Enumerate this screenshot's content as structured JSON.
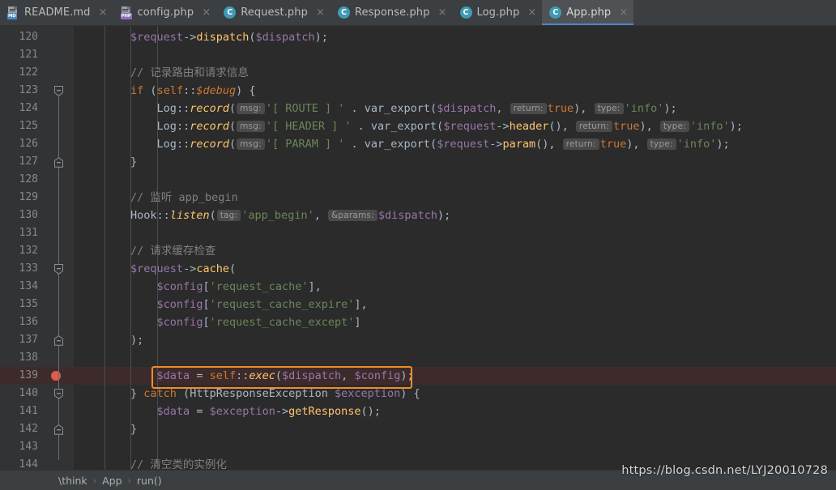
{
  "window": {
    "app": "PhpStorm",
    "theme_bg": "#2b2b2b",
    "accent": "#4a88c7",
    "annotation_color": "#f08b2b",
    "breakpoint_color": "#e05a52"
  },
  "tabs": [
    {
      "label": "README.md",
      "icon": "markdown-file-icon",
      "badge": "MD",
      "active": false,
      "close": "×"
    },
    {
      "label": "config.php",
      "icon": "php-file-icon",
      "badge": "PHP",
      "active": false,
      "close": "×"
    },
    {
      "label": "Request.php",
      "icon": "php-class-icon",
      "badge": "C",
      "active": false,
      "close": "×"
    },
    {
      "label": "Response.php",
      "icon": "php-class-icon",
      "badge": "C",
      "active": false,
      "close": "×"
    },
    {
      "label": "Log.php",
      "icon": "php-class-icon",
      "badge": "C",
      "active": false,
      "close": "×"
    },
    {
      "label": "App.php",
      "icon": "php-class-icon",
      "badge": "C",
      "active": true,
      "close": "×"
    }
  ],
  "editor": {
    "first_line": 120,
    "last_line": 144,
    "line_height": 22,
    "highlighted_line": 139,
    "breakpoint_line": 139,
    "fold_lines": [
      123,
      127,
      133,
      137,
      140,
      142
    ],
    "annotated_line": 139,
    "lines": [
      {
        "n": 120,
        "tokens": [
          {
            "t": "        ",
            "c": "plain"
          },
          {
            "t": "$request",
            "c": "var"
          },
          {
            "t": "->",
            "c": "def"
          },
          {
            "t": "dispatch",
            "c": "fn"
          },
          {
            "t": "(",
            "c": "def"
          },
          {
            "t": "$dispatch",
            "c": "var"
          },
          {
            "t": ");",
            "c": "def"
          }
        ]
      },
      {
        "n": 121,
        "tokens": []
      },
      {
        "n": 122,
        "tokens": [
          {
            "t": "        ",
            "c": "plain"
          },
          {
            "t": "// 记录路由和请求信息",
            "c": "cmt"
          }
        ]
      },
      {
        "n": 123,
        "tokens": [
          {
            "t": "        ",
            "c": "plain"
          },
          {
            "t": "if",
            "c": "kw"
          },
          {
            "t": " (",
            "c": "def"
          },
          {
            "t": "self",
            "c": "kw"
          },
          {
            "t": "::",
            "c": "def"
          },
          {
            "t": "$debug",
            "c": "kwi"
          },
          {
            "t": ") {",
            "c": "def"
          }
        ]
      },
      {
        "n": 124,
        "tokens": [
          {
            "t": "            ",
            "c": "plain"
          },
          {
            "t": "Log",
            "c": "def"
          },
          {
            "t": "::",
            "c": "def"
          },
          {
            "t": "record",
            "c": "itl"
          },
          {
            "t": "(",
            "c": "def"
          },
          {
            "t": "msg:",
            "c": "hint"
          },
          {
            "t": "'[ ROUTE ] '",
            "c": "str"
          },
          {
            "t": " . ",
            "c": "def"
          },
          {
            "t": "var_export",
            "c": "def"
          },
          {
            "t": "(",
            "c": "def"
          },
          {
            "t": "$dispatch",
            "c": "var"
          },
          {
            "t": ", ",
            "c": "def"
          },
          {
            "t": "return:",
            "c": "hint"
          },
          {
            "t": "true",
            "c": "kw"
          },
          {
            "t": "), ",
            "c": "def"
          },
          {
            "t": "type:",
            "c": "hint"
          },
          {
            "t": "'info'",
            "c": "str"
          },
          {
            "t": ");",
            "c": "def"
          }
        ]
      },
      {
        "n": 125,
        "tokens": [
          {
            "t": "            ",
            "c": "plain"
          },
          {
            "t": "Log",
            "c": "def"
          },
          {
            "t": "::",
            "c": "def"
          },
          {
            "t": "record",
            "c": "itl"
          },
          {
            "t": "(",
            "c": "def"
          },
          {
            "t": "msg:",
            "c": "hint"
          },
          {
            "t": "'[ HEADER ] '",
            "c": "str"
          },
          {
            "t": " . ",
            "c": "def"
          },
          {
            "t": "var_export",
            "c": "def"
          },
          {
            "t": "(",
            "c": "def"
          },
          {
            "t": "$request",
            "c": "var"
          },
          {
            "t": "->",
            "c": "def"
          },
          {
            "t": "header",
            "c": "fn"
          },
          {
            "t": "(), ",
            "c": "def"
          },
          {
            "t": "return:",
            "c": "hint"
          },
          {
            "t": "true",
            "c": "kw"
          },
          {
            "t": "), ",
            "c": "def"
          },
          {
            "t": "type:",
            "c": "hint"
          },
          {
            "t": "'info'",
            "c": "str"
          },
          {
            "t": ");",
            "c": "def"
          }
        ]
      },
      {
        "n": 126,
        "tokens": [
          {
            "t": "            ",
            "c": "plain"
          },
          {
            "t": "Log",
            "c": "def"
          },
          {
            "t": "::",
            "c": "def"
          },
          {
            "t": "record",
            "c": "itl"
          },
          {
            "t": "(",
            "c": "def"
          },
          {
            "t": "msg:",
            "c": "hint"
          },
          {
            "t": "'[ PARAM ] '",
            "c": "str"
          },
          {
            "t": " . ",
            "c": "def"
          },
          {
            "t": "var_export",
            "c": "def"
          },
          {
            "t": "(",
            "c": "def"
          },
          {
            "t": "$request",
            "c": "var"
          },
          {
            "t": "->",
            "c": "def"
          },
          {
            "t": "param",
            "c": "fn"
          },
          {
            "t": "(), ",
            "c": "def"
          },
          {
            "t": "return:",
            "c": "hint"
          },
          {
            "t": "true",
            "c": "kw"
          },
          {
            "t": "), ",
            "c": "def"
          },
          {
            "t": "type:",
            "c": "hint"
          },
          {
            "t": "'info'",
            "c": "str"
          },
          {
            "t": ");",
            "c": "def"
          }
        ]
      },
      {
        "n": 127,
        "tokens": [
          {
            "t": "        }",
            "c": "def"
          }
        ]
      },
      {
        "n": 128,
        "tokens": []
      },
      {
        "n": 129,
        "tokens": [
          {
            "t": "        ",
            "c": "plain"
          },
          {
            "t": "// 监听 app_begin",
            "c": "cmt"
          }
        ]
      },
      {
        "n": 130,
        "tokens": [
          {
            "t": "        ",
            "c": "plain"
          },
          {
            "t": "Hook",
            "c": "def"
          },
          {
            "t": "::",
            "c": "def"
          },
          {
            "t": "listen",
            "c": "itl"
          },
          {
            "t": "(",
            "c": "def"
          },
          {
            "t": "tag:",
            "c": "hint"
          },
          {
            "t": "'app_begin'",
            "c": "str"
          },
          {
            "t": ", ",
            "c": "def"
          },
          {
            "t": "&params:",
            "c": "hint"
          },
          {
            "t": "$dispatch",
            "c": "var"
          },
          {
            "t": ");",
            "c": "def"
          }
        ]
      },
      {
        "n": 131,
        "tokens": []
      },
      {
        "n": 132,
        "tokens": [
          {
            "t": "        ",
            "c": "plain"
          },
          {
            "t": "// 请求缓存检查",
            "c": "cmt"
          }
        ]
      },
      {
        "n": 133,
        "tokens": [
          {
            "t": "        ",
            "c": "plain"
          },
          {
            "t": "$request",
            "c": "var"
          },
          {
            "t": "->",
            "c": "def"
          },
          {
            "t": "cache",
            "c": "fn"
          },
          {
            "t": "(",
            "c": "def"
          }
        ]
      },
      {
        "n": 134,
        "tokens": [
          {
            "t": "            ",
            "c": "plain"
          },
          {
            "t": "$config",
            "c": "var"
          },
          {
            "t": "[",
            "c": "def"
          },
          {
            "t": "'request_cache'",
            "c": "str"
          },
          {
            "t": "],",
            "c": "def"
          }
        ]
      },
      {
        "n": 135,
        "tokens": [
          {
            "t": "            ",
            "c": "plain"
          },
          {
            "t": "$config",
            "c": "var"
          },
          {
            "t": "[",
            "c": "def"
          },
          {
            "t": "'request_cache_expire'",
            "c": "str"
          },
          {
            "t": "],",
            "c": "def"
          }
        ]
      },
      {
        "n": 136,
        "tokens": [
          {
            "t": "            ",
            "c": "plain"
          },
          {
            "t": "$config",
            "c": "var"
          },
          {
            "t": "[",
            "c": "def"
          },
          {
            "t": "'request_cache_except'",
            "c": "str"
          },
          {
            "t": "]",
            "c": "def"
          }
        ]
      },
      {
        "n": 137,
        "tokens": [
          {
            "t": "        );",
            "c": "def"
          }
        ]
      },
      {
        "n": 138,
        "tokens": []
      },
      {
        "n": 139,
        "tokens": [
          {
            "t": "            ",
            "c": "plain"
          },
          {
            "t": "$data",
            "c": "var"
          },
          {
            "t": " = ",
            "c": "def"
          },
          {
            "t": "self",
            "c": "kw"
          },
          {
            "t": "::",
            "c": "def"
          },
          {
            "t": "exec",
            "c": "itl"
          },
          {
            "t": "(",
            "c": "def"
          },
          {
            "t": "$dispatch",
            "c": "var"
          },
          {
            "t": ", ",
            "c": "def"
          },
          {
            "t": "$config",
            "c": "var"
          },
          {
            "t": ");",
            "c": "def"
          }
        ]
      },
      {
        "n": 140,
        "tokens": [
          {
            "t": "        } ",
            "c": "def"
          },
          {
            "t": "catch",
            "c": "kw"
          },
          {
            "t": " (",
            "c": "def"
          },
          {
            "t": "HttpResponseException",
            "c": "def"
          },
          {
            "t": " ",
            "c": "plain"
          },
          {
            "t": "$exception",
            "c": "var"
          },
          {
            "t": ") {",
            "c": "def"
          }
        ]
      },
      {
        "n": 141,
        "tokens": [
          {
            "t": "            ",
            "c": "plain"
          },
          {
            "t": "$data",
            "c": "var"
          },
          {
            "t": " = ",
            "c": "def"
          },
          {
            "t": "$exception",
            "c": "var"
          },
          {
            "t": "->",
            "c": "def"
          },
          {
            "t": "getResponse",
            "c": "fn"
          },
          {
            "t": "();",
            "c": "def"
          }
        ]
      },
      {
        "n": 142,
        "tokens": [
          {
            "t": "        }",
            "c": "def"
          }
        ]
      },
      {
        "n": 143,
        "tokens": []
      },
      {
        "n": 144,
        "tokens": [
          {
            "t": "        ",
            "c": "plain"
          },
          {
            "t": "// 清空类的实例化",
            "c": "cmt"
          }
        ]
      }
    ]
  },
  "statusbar": {
    "breadcrumb": [
      "\\think",
      "App",
      "run()"
    ],
    "separator": "›"
  },
  "watermark": {
    "text": "https://blog.csdn.net/LYJ20010728"
  }
}
